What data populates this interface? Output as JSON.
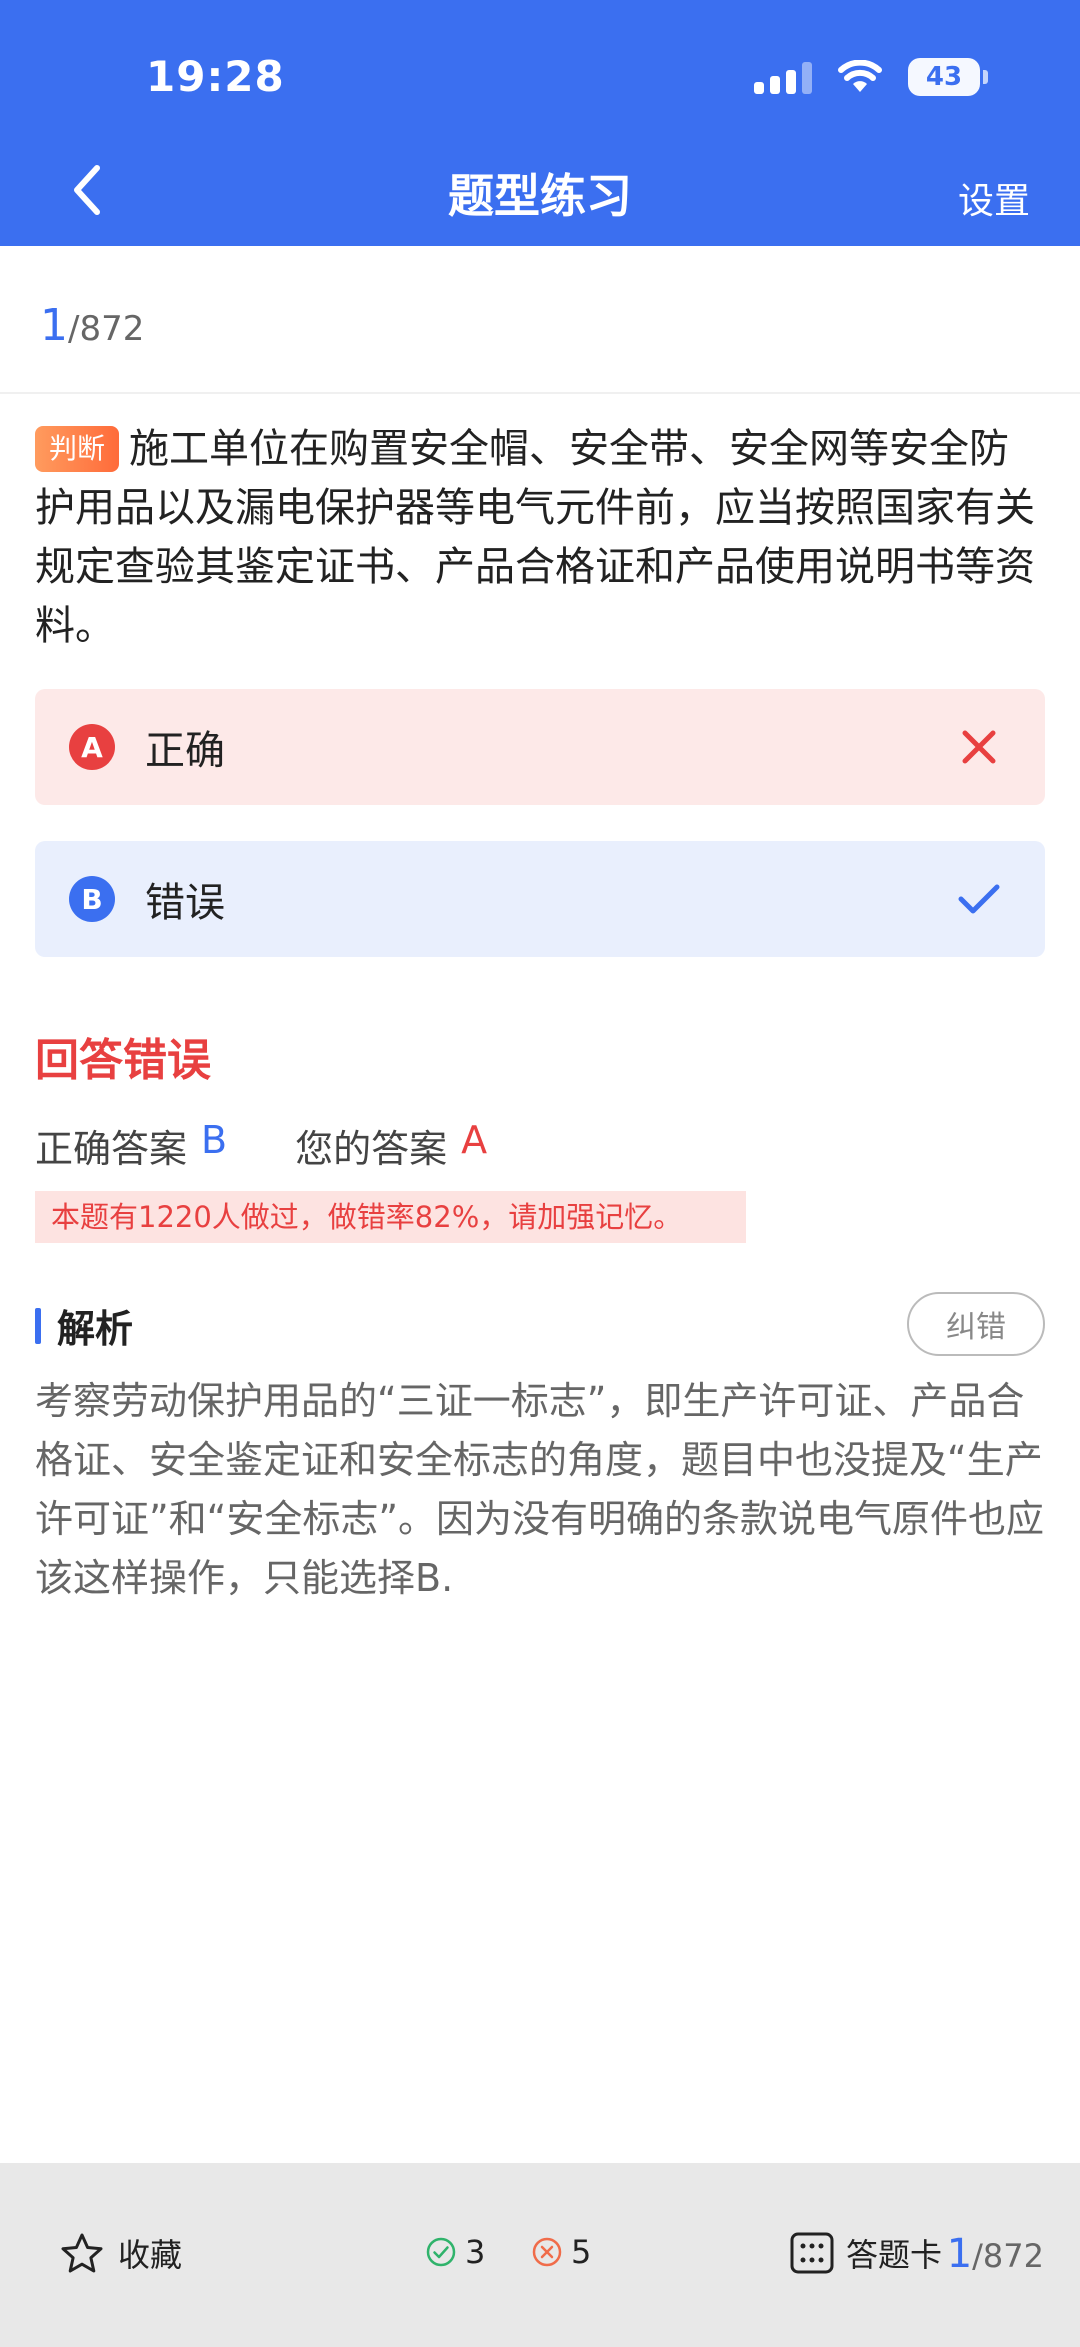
{
  "status_bar": {
    "time": "19:28",
    "battery": "43"
  },
  "nav": {
    "title": "题型练习",
    "settings_label": "设置"
  },
  "progress": {
    "current": "1",
    "total": "/872"
  },
  "question": {
    "tag": "判断",
    "text": "施工单位在购置安全帽、安全带、安全网等安全防护用品以及漏电保护器等电气元件前，应当按照国家有关规定查验其鉴定证书、产品合格证和产品使用说明书等资料。"
  },
  "options": [
    {
      "letter": "A",
      "text": "正确",
      "state": "wrong",
      "mark_color": "#e84040"
    },
    {
      "letter": "B",
      "text": "错误",
      "state": "correct",
      "mark_color": "#3b6ff0"
    }
  ],
  "result": {
    "title": "回答错误",
    "correct_label": "正确答案",
    "correct_value": "B",
    "yours_label": "您的答案",
    "yours_value": "A",
    "warning": "本题有1220人做过，做错率82%，请加强记忆。"
  },
  "analysis": {
    "title": "解析",
    "report_label": "纠错",
    "text": "考察劳动保护用品的“三证一标志”，即生产许可证、产品合格证、安全鉴定证和安全标志的角度，题目中也没提及“生产许可证”和“安全标志”。因为没有明确的条款说电气原件也应该这样操作，只能选择B."
  },
  "bottom_bar": {
    "favorite_label": "收藏",
    "correct_count": "3",
    "wrong_count": "5",
    "card_label": "答题卡",
    "progress_current": "1",
    "progress_total": "/872"
  },
  "colors": {
    "primary": "#3b6ff0",
    "error": "#e84040",
    "tag": "#ff7a45"
  }
}
